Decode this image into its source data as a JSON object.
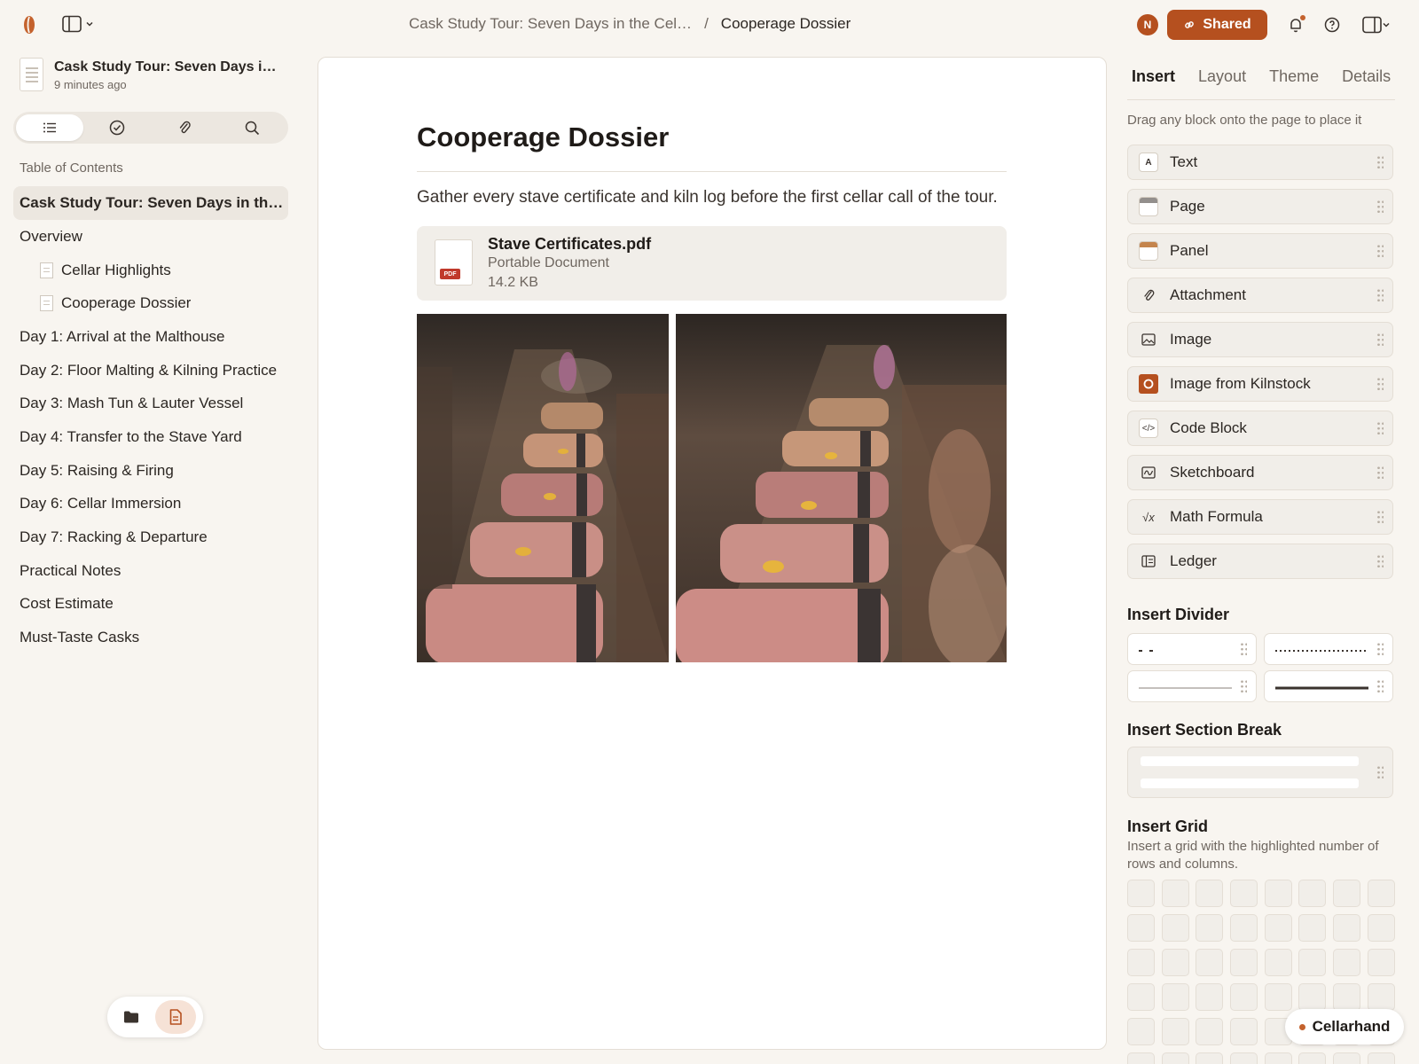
{
  "breadcrumb": {
    "parent": "Cask Study Tour: Seven Days in the Cel…",
    "separator": "/",
    "current": "Cooperage Dossier"
  },
  "header": {
    "avatar_initial": "N",
    "shared_label": "Shared",
    "accent_color": "#b5501f"
  },
  "sidebar": {
    "doc_title": "Cask Study Tour: Seven Days in …",
    "doc_updated": "9 minutes ago",
    "segments": [
      {
        "icon": "list-icon",
        "active": true
      },
      {
        "icon": "check-circle-icon",
        "active": false
      },
      {
        "icon": "paperclip-icon",
        "active": false
      },
      {
        "icon": "search-icon",
        "active": false
      }
    ],
    "toc_label": "Table of Contents",
    "toc": [
      {
        "label": "Cask Study Tour: Seven Days in the …",
        "active": true
      },
      {
        "label": "Overview"
      },
      {
        "label": "Cellar Highlights",
        "sub": true
      },
      {
        "label": "Cooperage Dossier",
        "sub": true
      },
      {
        "label": "Day 1: Arrival at the Malthouse"
      },
      {
        "label": "Day 2: Floor Malting & Kilning Practice"
      },
      {
        "label": "Day 3: Mash Tun & Lauter Vessel"
      },
      {
        "label": "Day 4: Transfer to the Stave Yard"
      },
      {
        "label": "Day 5: Raising & Firing"
      },
      {
        "label": "Day 6: Cellar Immersion"
      },
      {
        "label": "Day 7: Racking & Departure"
      },
      {
        "label": "Practical Notes"
      },
      {
        "label": "Cost Estimate"
      },
      {
        "label": "Must-Taste Casks"
      }
    ]
  },
  "page": {
    "title": "Cooperage Dossier",
    "intro": "Gather every stave certificate and kiln log before the first cellar call of the tour.",
    "attachment": {
      "name": "Stave Certificates.pdf",
      "type": "Portable Document",
      "size": "14.2 KB",
      "badge": "PDF"
    }
  },
  "panel": {
    "tabs": [
      {
        "label": "Insert",
        "active": true
      },
      {
        "label": "Layout"
      },
      {
        "label": "Theme"
      },
      {
        "label": "Details"
      }
    ],
    "hint": "Drag any block onto the page to place it",
    "blocks": [
      {
        "label": "Text",
        "icon": "text-icon",
        "glyph": "A"
      },
      {
        "label": "Page",
        "icon": "page-icon"
      },
      {
        "label": "Panel",
        "icon": "panel-icon"
      },
      {
        "label": "Attachment",
        "icon": "paperclip-icon"
      },
      {
        "label": "Image",
        "icon": "image-icon"
      },
      {
        "label": "Image from Kilnstock",
        "icon": "kilnstock-icon"
      },
      {
        "label": "Code Block",
        "icon": "code-icon",
        "glyph": "</>"
      },
      {
        "label": "Sketchboard",
        "icon": "sketchboard-icon"
      },
      {
        "label": "Math Formula",
        "icon": "math-icon",
        "glyph": "√x"
      },
      {
        "label": "Ledger",
        "icon": "ledger-icon"
      }
    ],
    "divider_title": "Insert Divider",
    "section_break_title": "Insert Section Break",
    "grid_title": "Insert Grid",
    "grid_desc": "Insert a grid with the highlighted number of rows and columns."
  },
  "brand": {
    "name": "Cellarhand"
  }
}
